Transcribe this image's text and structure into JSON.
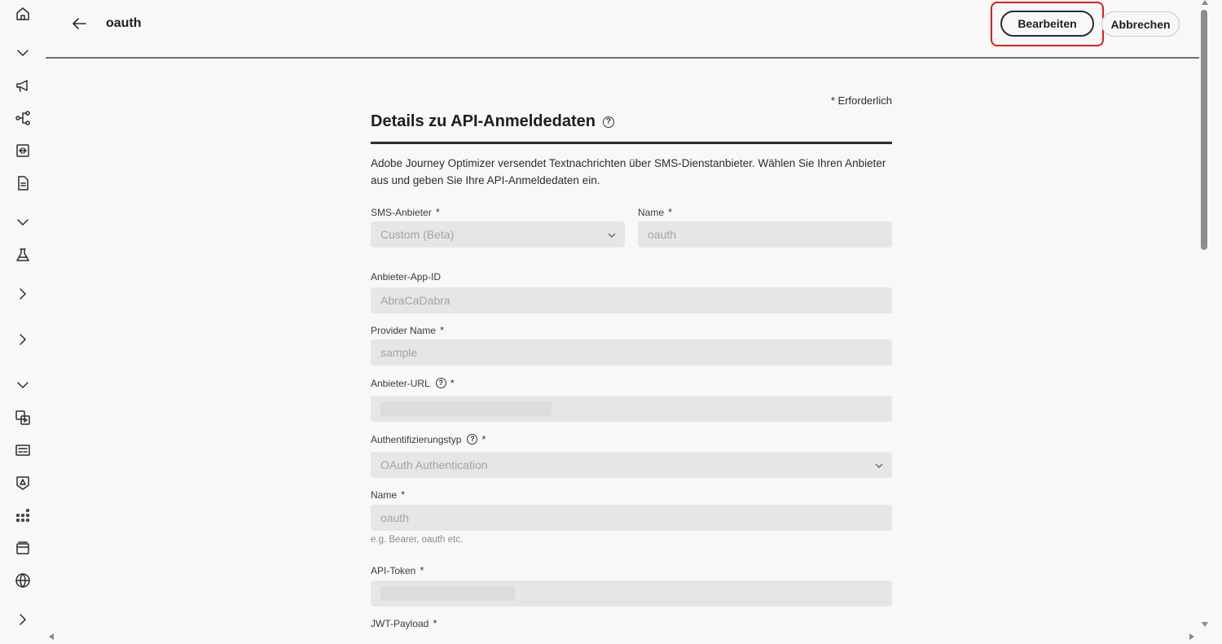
{
  "header": {
    "title": "oauth",
    "edit_label": "Bearbeiten",
    "cancel_label": "Abbrechen"
  },
  "rail": {
    "icons": [
      "home-icon",
      "chevron-down-icon",
      "megaphone-icon",
      "journey-icon",
      "content-icon",
      "document-icon",
      "chevron-down-icon",
      "experiment-icon",
      "chevron-right-icon",
      "chevron-right-icon",
      "chevron-down-icon",
      "templates-icon",
      "fragments-icon",
      "brand-icon",
      "catalog-icon",
      "channels-icon",
      "globe-icon",
      "chevron-right-icon"
    ]
  },
  "form": {
    "required_note": "* Erforderlich",
    "section_title": "Details zu API-Anmeldedaten",
    "description": "Adobe Journey Optimizer versendet Textnachrichten über SMS-Dienstanbieter. Wählen Sie Ihren Anbieter aus und geben Sie Ihre API-Anmeldedaten ein.",
    "sms_provider": {
      "label": "SMS-Anbieter",
      "value": "Custom (Beta)"
    },
    "name": {
      "label": "Name",
      "value": "oauth"
    },
    "app_id": {
      "label": "Anbieter-App-ID",
      "value": "AbraCaDabra"
    },
    "provider_name": {
      "label": "Provider Name",
      "value": "sample"
    },
    "provider_url": {
      "label": "Anbieter-URL"
    },
    "auth_type": {
      "label": "Authentifizierungstyp",
      "value": "OAuth Authentication"
    },
    "auth_name": {
      "label": "Name",
      "value": "oauth",
      "hint": "e.g. Bearer, oauth etc."
    },
    "api_token": {
      "label": "API-Token"
    },
    "jwt_payload": {
      "label": "JWT-Payload"
    },
    "required_mark": "*",
    "help_mark": "?"
  },
  "colors": {
    "highlight": "#e31b1b",
    "field_bg": "#e6e6e6",
    "background": "#f8f8f8"
  }
}
